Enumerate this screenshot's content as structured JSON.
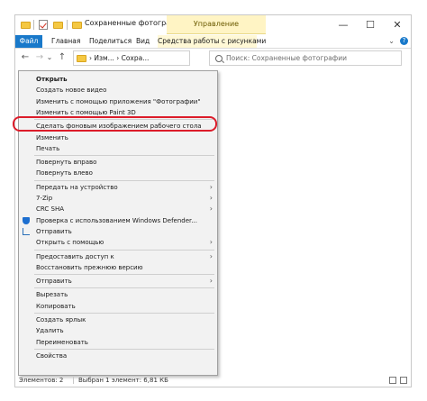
{
  "window": {
    "title": "Сохраненные фотографии",
    "manage_tab": "Управление",
    "controls": {
      "minimize": "—",
      "maximize": "☐",
      "close": "✕"
    }
  },
  "ribbon": {
    "tabs": [
      "Файл",
      "Главная",
      "Поделиться",
      "Вид"
    ],
    "manage_label": "Средства работы с рисунками",
    "chevron": "⌄",
    "help": "?"
  },
  "navbar": {
    "back": "←",
    "forward": "→",
    "recent": "⌄",
    "up": "↑",
    "path": [
      "Изм...",
      "Сохра..."
    ],
    "search_placeholder": "Поиск: Сохраненные фотографии"
  },
  "context_menu": {
    "items": [
      {
        "label": "Открыть",
        "bold": true
      },
      {
        "label": "Создать новое видео"
      },
      {
        "label": "Изменить с помощью приложения \"Фотографии\""
      },
      {
        "label": "Изменить с помощью Paint 3D"
      },
      {
        "sep": true
      },
      {
        "label": "Сделать фоновым изображением рабочего стола",
        "highlighted": true
      },
      {
        "label": "Изменить"
      },
      {
        "label": "Печать"
      },
      {
        "sep": true
      },
      {
        "label": "Повернуть вправо"
      },
      {
        "label": "Повернуть влево"
      },
      {
        "sep": true
      },
      {
        "label": "Передать на устройство",
        "arrow": true
      },
      {
        "label": "7-Zip",
        "arrow": true
      },
      {
        "label": "CRC SHA",
        "arrow": true
      },
      {
        "label": "Проверка с использованием Windows Defender...",
        "icon": "shield-icon"
      },
      {
        "label": "Отправить",
        "icon": "share-icon"
      },
      {
        "label": "Открыть с помощью",
        "arrow": true
      },
      {
        "sep": true
      },
      {
        "label": "Предоставить доступ к",
        "arrow": true
      },
      {
        "label": "Восстановить прежнюю версию"
      },
      {
        "sep": true
      },
      {
        "label": "Отправить",
        "arrow": true
      },
      {
        "sep": true
      },
      {
        "label": "Вырезать"
      },
      {
        "label": "Копировать"
      },
      {
        "sep": true
      },
      {
        "label": "Создать ярлык"
      },
      {
        "label": "Удалить"
      },
      {
        "label": "Переименовать"
      },
      {
        "sep": true
      },
      {
        "label": "Свойства"
      }
    ]
  },
  "statusbar": {
    "count": "Элементов: 2",
    "selected": "Выбран 1 элемент: 6,81 КБ"
  },
  "colors": {
    "accent": "#1979ca",
    "highlight_ring": "#dc1c2a",
    "manage_bg": "#fff4c4"
  }
}
